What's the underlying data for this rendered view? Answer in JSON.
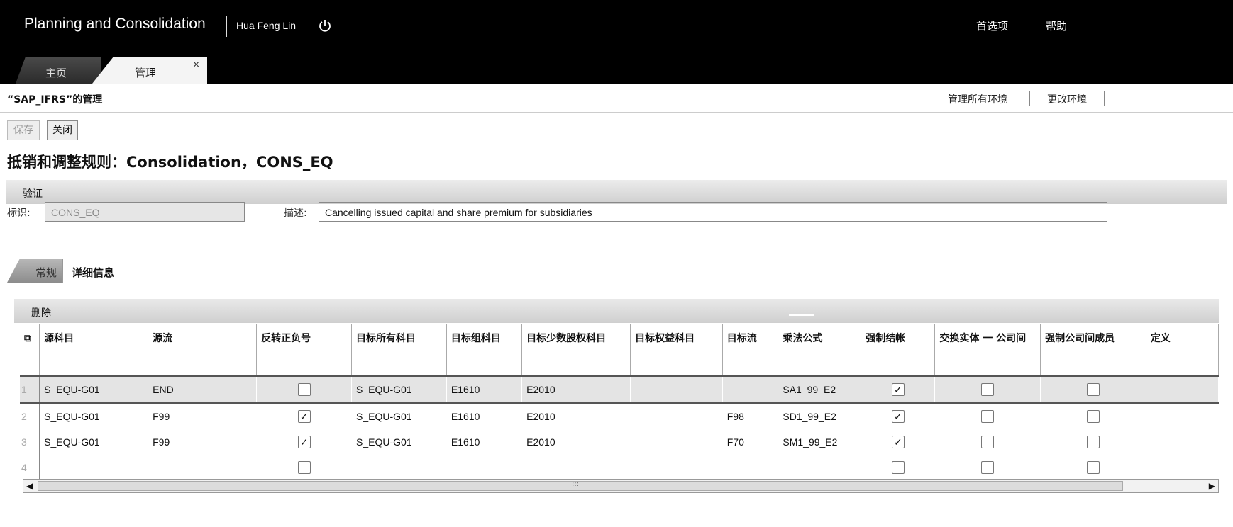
{
  "app": {
    "title": "Planning and Consolidation",
    "user": "Hua Feng Lin",
    "links": [
      "首选项",
      "帮助"
    ]
  },
  "tabs": [
    {
      "label": "主页"
    },
    {
      "label": "管理",
      "close": "×"
    }
  ],
  "subheader": {
    "title": "“SAP_IFRS”的管理",
    "links": [
      "管理所有环境",
      "更改环境"
    ]
  },
  "toolbar": {
    "save_label": "保存",
    "close_label": "关闭"
  },
  "page_heading": "抵销和调整规则：Consolidation，CONS_EQ",
  "validate_label": "验证",
  "form": {
    "id_label": "标识:",
    "id_value": "CONS_EQ",
    "desc_label": "描述:",
    "desc_value": "Cancelling issued capital and share premium for subsidiaries"
  },
  "subtabs": [
    {
      "label": "常规"
    },
    {
      "label": "详细信息"
    }
  ],
  "grid": {
    "delete_label": "删除",
    "columns": [
      "源科目",
      "源流",
      "反转正负号",
      "目标所有科目",
      "目标组科目",
      "目标少数股权科目",
      "目标权益科目",
      "目标流",
      "乘法公式",
      "强制结帐",
      "交换实体 一 公司间",
      "强制公司间成员",
      "定义"
    ],
    "rows": [
      {
        "num": "1",
        "src_account": "S_EQU-G01",
        "src_flow": "END",
        "reverse": false,
        "all_account": "S_EQU-G01",
        "group_account": "E1610",
        "minority_account": "E2010",
        "equity_account": "",
        "target_flow": "",
        "formula": "SA1_99_E2",
        "force_close": true,
        "swap_entity": false,
        "force_ic": false
      },
      {
        "num": "2",
        "src_account": "S_EQU-G01",
        "src_flow": "F99",
        "reverse": true,
        "all_account": "S_EQU-G01",
        "group_account": "E1610",
        "minority_account": "E2010",
        "equity_account": "",
        "target_flow": "F98",
        "formula": "SD1_99_E2",
        "force_close": true,
        "swap_entity": false,
        "force_ic": false
      },
      {
        "num": "3",
        "src_account": "S_EQU-G01",
        "src_flow": "F99",
        "reverse": true,
        "all_account": "S_EQU-G01",
        "group_account": "E1610",
        "minority_account": "E2010",
        "equity_account": "",
        "target_flow": "F70",
        "formula": "SM1_99_E2",
        "force_close": true,
        "swap_entity": false,
        "force_ic": false
      },
      {
        "num": "4",
        "src_account": "",
        "src_flow": "",
        "reverse": false,
        "all_account": "",
        "group_account": "",
        "minority_account": "",
        "equity_account": "",
        "target_flow": "",
        "formula": "",
        "force_close": false,
        "swap_entity": false,
        "force_ic": false
      }
    ]
  },
  "icons": {
    "power": "power-icon",
    "column-chooser": "column-chooser-icon",
    "scroll-left": "◀",
    "scroll-right": "▶"
  }
}
